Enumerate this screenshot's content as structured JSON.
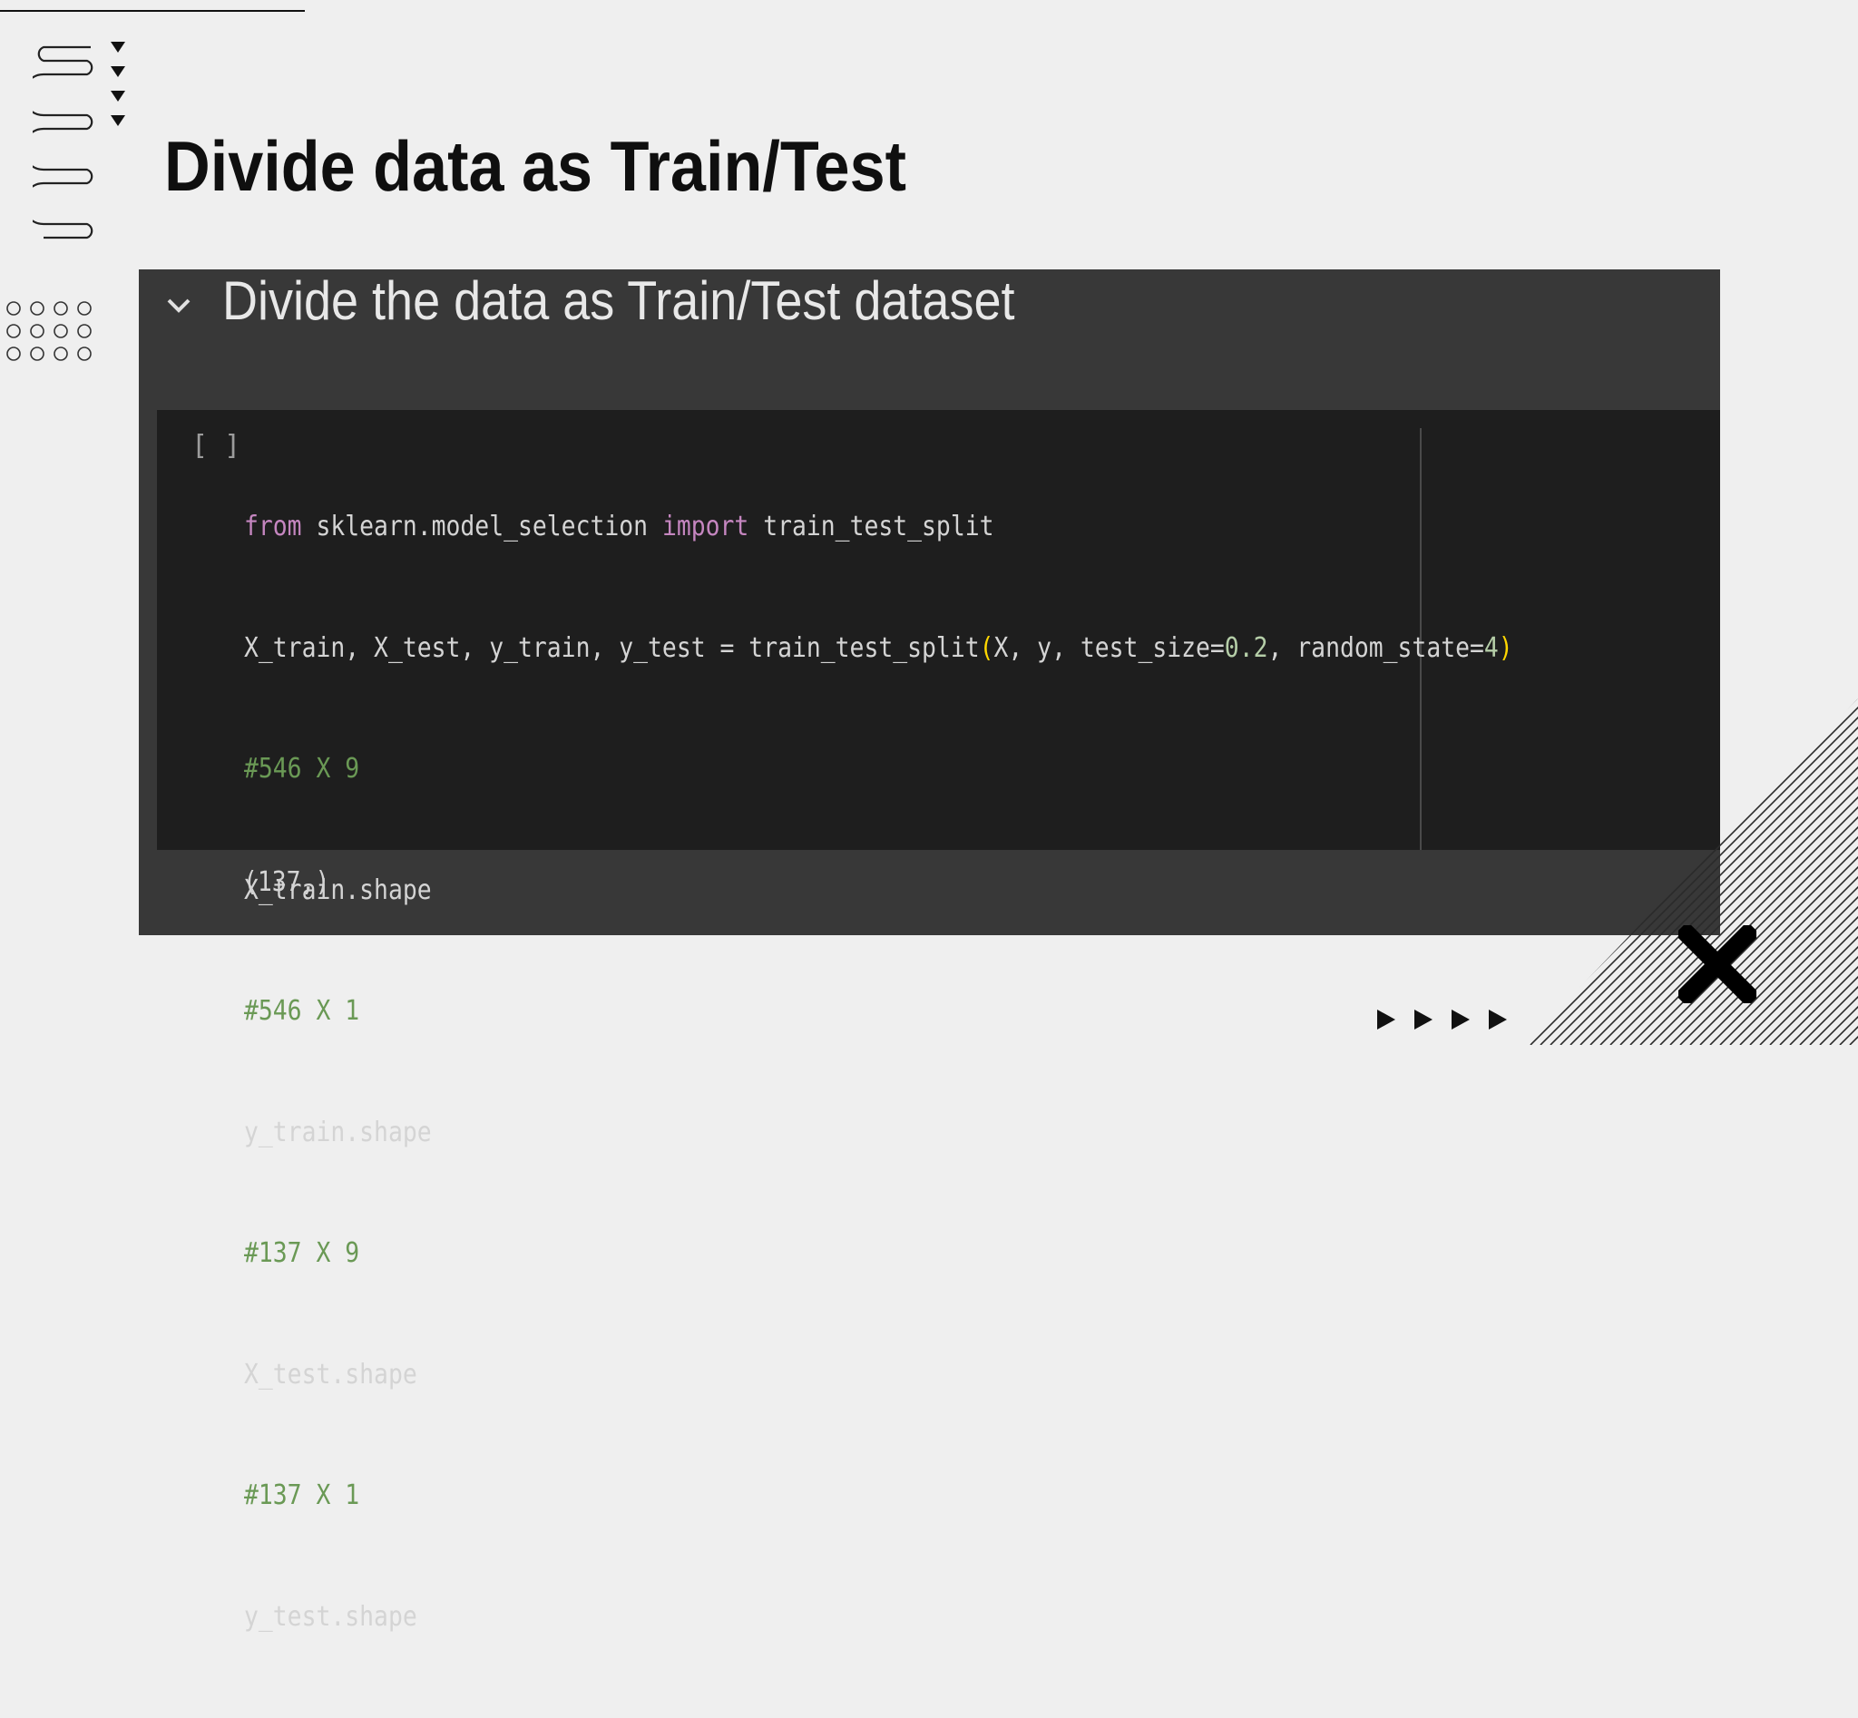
{
  "slide": {
    "title": "Divide data as Train/Test"
  },
  "notebook": {
    "section_title": "Divide the data as Train/Test dataset",
    "run_indicator": "[ ]",
    "code": {
      "l1": {
        "kw1": "from",
        "t1": " sklearn.model_selection ",
        "kw2": "import",
        "t2": " train_test_split"
      },
      "l2": {
        "t1": "X_train, X_test, y_train, y_test = train_test_split",
        "p1": "(",
        "t2": "X, y, test_size=",
        "n1": "0.2",
        "t3": ", random_state=",
        "n2": "4",
        "p2": ")"
      },
      "l3": "#546 X 9",
      "l4": "X_train.shape",
      "l5": "#546 X 1",
      "l6": "y_train.shape",
      "l7": "#137 X 9",
      "l8": "X_test.shape",
      "l9": "#137 X 1",
      "l10": "y_test.shape"
    },
    "output": "(137,)"
  },
  "colors": {
    "slide_background": "#efefef",
    "notebook_background": "#383838",
    "code_background": "#1e1e1e",
    "keyword": "#c586c0",
    "comment": "#6a9955",
    "number": "#b5cea8",
    "bracket": "#ffd700"
  },
  "icons": {
    "section_toggle": "chevron-down-icon",
    "decorations": [
      "squiggle-decoration",
      "triangle-arrows-decoration",
      "circle-grid-decoration",
      "diagonal-hatch-decoration",
      "x-mark-icon",
      "play-arrows-decoration"
    ]
  }
}
